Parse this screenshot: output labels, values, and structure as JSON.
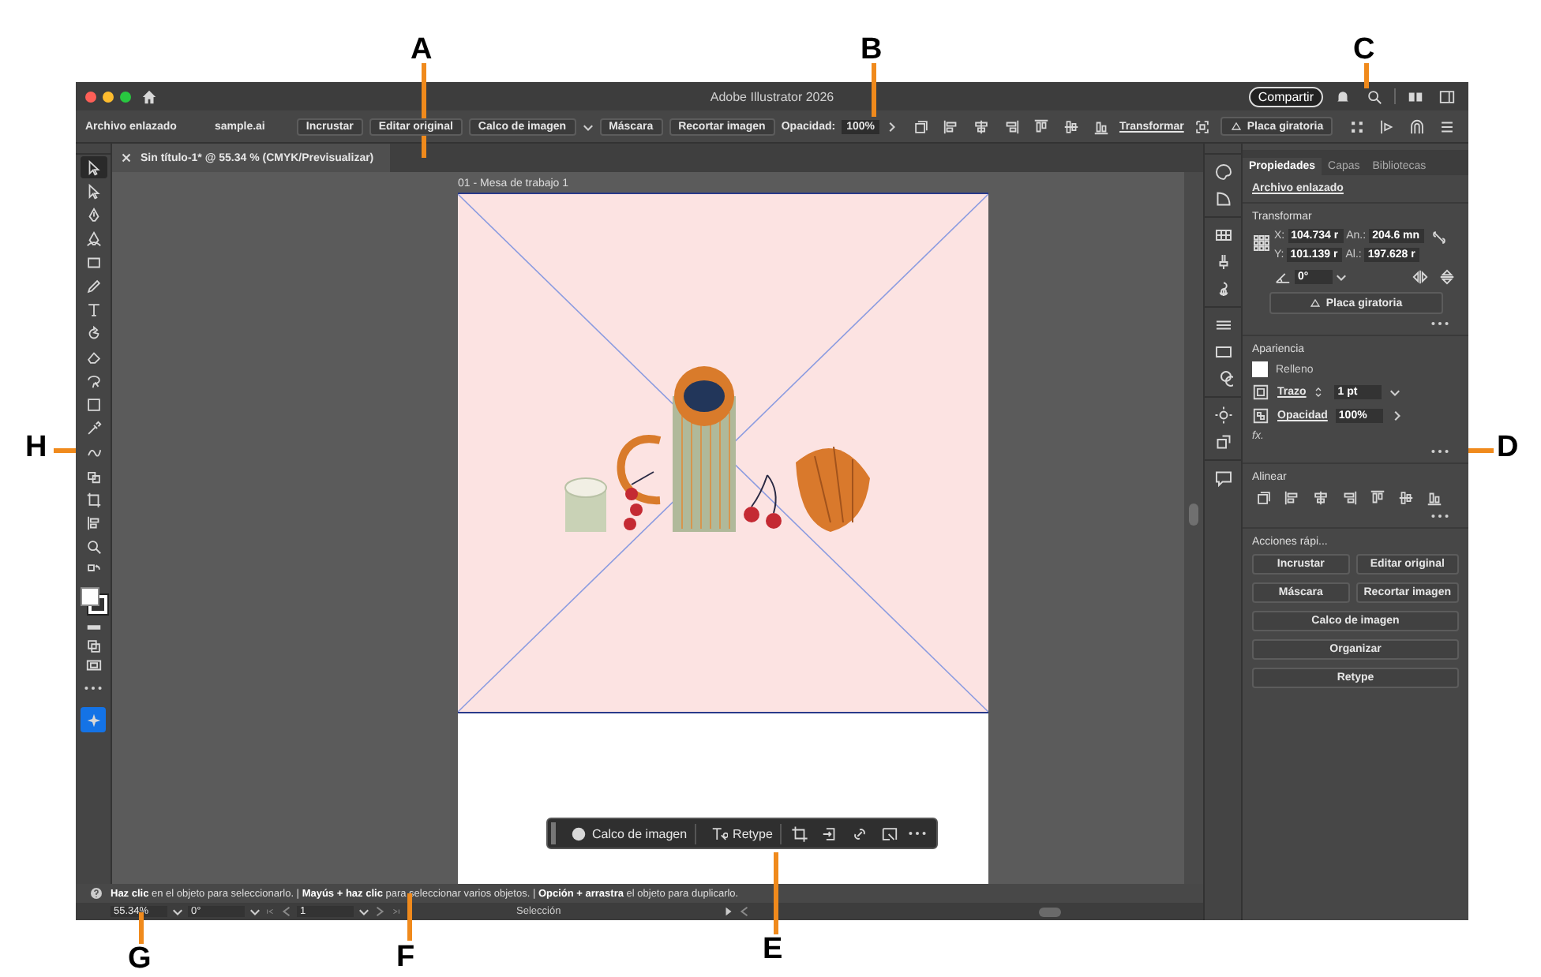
{
  "callouts": [
    {
      "label": "A"
    },
    {
      "label": "B"
    },
    {
      "label": "C"
    },
    {
      "label": "H"
    },
    {
      "label": "D"
    },
    {
      "label": "G"
    },
    {
      "label": "F"
    },
    {
      "label": "E"
    }
  ],
  "window": {
    "title": "Adobe Illustrator 2026",
    "share_button": "Compartir"
  },
  "control_bar": {
    "object_type": "Archivo enlazado",
    "file_name": "sample.ai",
    "buttons": [
      {
        "kind": "button",
        "text": "Incrustar"
      },
      {
        "kind": "button",
        "text": "Editar original"
      },
      {
        "kind": "dropdown",
        "text": "Calco de imagen"
      },
      {
        "kind": "button",
        "text": "Máscara"
      },
      {
        "kind": "button",
        "text": "Recortar imagen"
      }
    ],
    "opacity_label": "Opacidad:",
    "opacity_value": "100%",
    "transform_link": "Transformar",
    "mockup_button": "Placa giratoria"
  },
  "document_tab": {
    "title": "Sin título-1* @ 55.34 % (CMYK/Previsualizar)"
  },
  "artboard": {
    "name": "01 - Mesa de trabajo 1"
  },
  "tools": [
    {
      "selected": true
    },
    {
      "selected": false
    },
    {
      "selected": false
    },
    {
      "selected": false
    },
    {
      "selected": false
    },
    {
      "selected": false
    },
    {
      "selected": false
    },
    {
      "selected": false
    },
    {
      "selected": false
    },
    {
      "selected": false
    },
    {
      "selected": false
    },
    {
      "selected": false
    },
    {
      "selected": false
    },
    {
      "selected": false
    },
    {
      "selected": false
    },
    {
      "selected": false
    },
    {
      "selected": false
    },
    {
      "selected": false
    }
  ],
  "context_bar": {
    "buttons": [
      "Calco de imagen",
      "Retype"
    ]
  },
  "hint": "**Haz clic** en el objeto para seleccionarlo.  |  **Mayús + haz clic** para seleccionar varios objetos.  |  **Opción + arrastra** el objeto para duplicarlo.",
  "status_bar": {
    "zoom": "55.34%",
    "rotation": "0°",
    "artboard_number": "1",
    "tool": "Selección"
  },
  "panel": {
    "tabs": [
      {
        "label": "Propiedades",
        "selected": true
      },
      {
        "label": "Capas",
        "selected": false
      },
      {
        "label": "Bibliotecas",
        "selected": false
      }
    ],
    "object_type": "Archivo enlazado",
    "transform": {
      "title": "Transformar",
      "x_label": "X:",
      "x": "104.734 r",
      "w_label": "An.:",
      "w": "204.6 mn",
      "y_label": "Y:",
      "y": "101.139 r",
      "h_label": "Al.:",
      "h": "197.628 r",
      "angle": "0°",
      "button": "Placa giratoria"
    },
    "appearance": {
      "title": "Apariencia",
      "fill_label": "Relleno",
      "stroke_label": "Trazo",
      "stroke_value": "1 pt",
      "opacity_label": "Opacidad",
      "opacity_value": "100%",
      "fx": "fx."
    },
    "align": {
      "title": "Alinear"
    },
    "quick_actions": {
      "title": "Acciones rápi...",
      "buttons": [
        "Incrustar",
        "Editar original",
        "Máscara",
        "Recortar imagen",
        "Calco de imagen",
        "Organizar",
        "Retype"
      ]
    }
  }
}
